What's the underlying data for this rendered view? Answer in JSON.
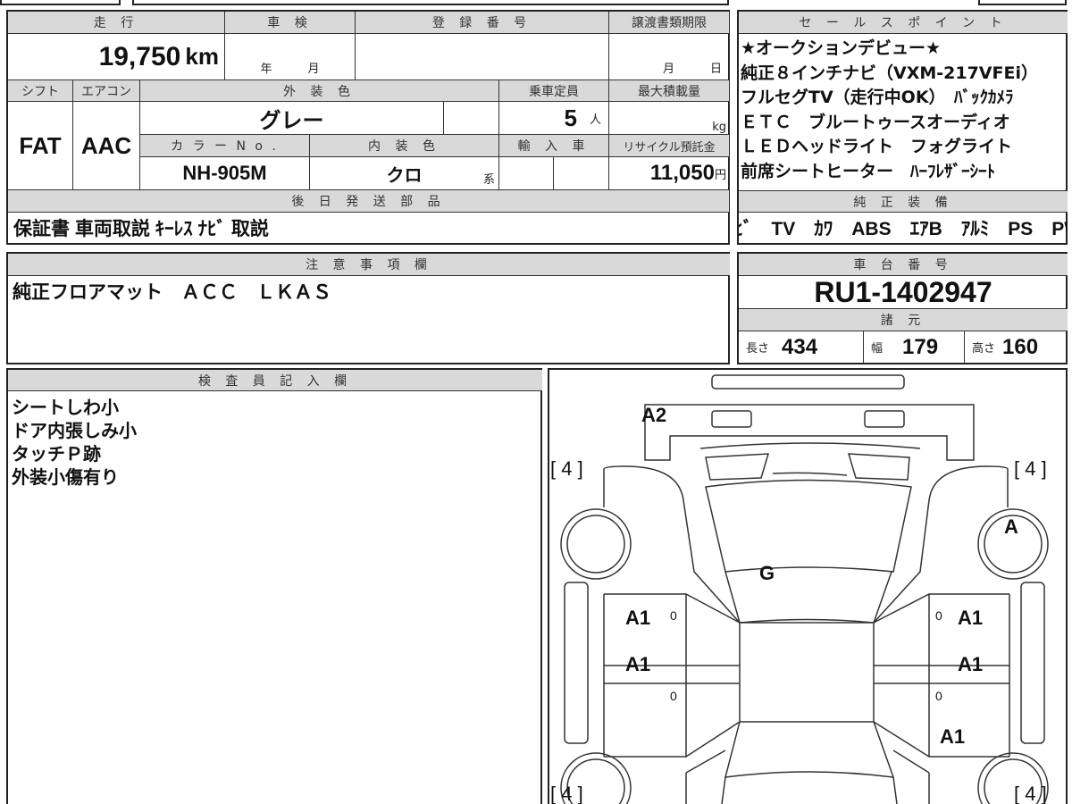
{
  "main": {
    "headers": {
      "mileage": "走 行",
      "inspection": "車 検",
      "registration": "登 録 番 号",
      "transfer_deadline": "譲渡書類期限",
      "shift": "シフト",
      "aircon": "エアコン",
      "exterior_color": "外 装 色",
      "capacity": "乗車定員",
      "max_load": "最大積載量",
      "color_no": "カ ラ ー N o .",
      "interior_color": "内 装 色",
      "imported": "輸 入 車",
      "recycle": "リサイクル預託金",
      "later_parts": "後 日 発 送 部 品"
    },
    "mileage": "19,750",
    "mileage_unit": "km",
    "inspection_year": "年",
    "inspection_month": "月",
    "deadline_month": "月",
    "deadline_day": "日",
    "shift": "FAT",
    "aircon": "AAC",
    "exterior_color": "グレー",
    "capacity": "5",
    "capacity_unit": "人",
    "load_unit": "kg",
    "color_no": "NH-905M",
    "interior_color": "クロ",
    "interior_suffix": "系",
    "recycle": "11,050",
    "recycle_unit": "円",
    "later_parts": "保証書 車両取説 ｷｰﾚｽ ﾅﾋﾞ 取説"
  },
  "sales": {
    "header": "セ ー ル ス ポ イ ン ト",
    "lines": [
      "★オークションデビュー★",
      "純正８インチナビ（VXM-217VFEi）",
      "フルセグTV（走行中OK）　ﾊﾞｯｸｶﾒﾗ",
      "ＥＴＣ　ブルートゥースオーディオ",
      "ＬＥＤヘッドライト　フォグライト",
      "前席シートヒーター　ﾊｰﾌﾚｻﾞｰｼｰﾄ"
    ]
  },
  "equipment": {
    "header": "純 正 装 備",
    "items": "ﾅﾋﾞ　TV　ｶﾜ　ABS　ｴｱB　ｱﾙﾐ　PS　PW"
  },
  "notes": {
    "header": "注 意 事 項 欄",
    "text": "純正フロアマット　ＡＣＣ　ＬＫＡＳ"
  },
  "chassis": {
    "header": "車 台 番 号",
    "number": "RU1-1402947",
    "spec_header": "諸 元",
    "length_label": "長さ",
    "length": "434",
    "width_label": "幅",
    "width": "179",
    "height_label": "高さ",
    "height": "160"
  },
  "inspector": {
    "header": "検 査 員 記 入 欄",
    "lines": [
      "シートしわ小",
      "ドア内張しみ小",
      "タッチＰ跡",
      "外装小傷有り"
    ]
  },
  "diagram": {
    "tire_fl": "[ 4 ]",
    "tire_fr": "[ 4 ]",
    "tire_rl": "[ 4 ]",
    "tire_rr": "[ 4 ]",
    "rear_bumper": "A2",
    "wheel_fr": "A",
    "roof": "G",
    "door_l1": "A1",
    "door_r1": "A1",
    "door_l2": "A1",
    "door_r2": "A1",
    "fender_r": "A1",
    "mark": "0"
  }
}
